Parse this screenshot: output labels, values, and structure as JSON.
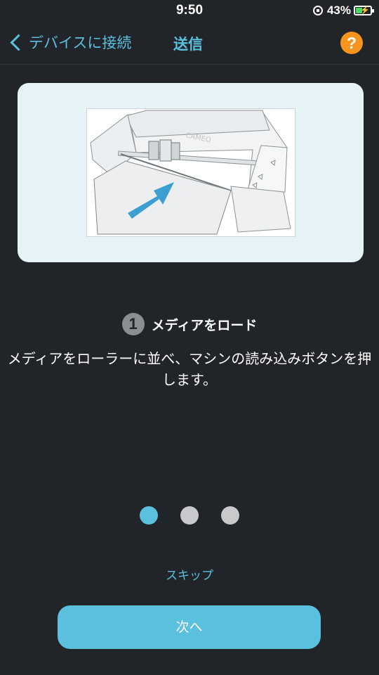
{
  "status_bar": {
    "time": "9:50",
    "battery_percent": "43%",
    "battery_level": 0.43,
    "icons": [
      "rotation-lock-icon",
      "battery-charging-icon"
    ]
  },
  "nav": {
    "back_label": "デバイスに接続",
    "title": "送信",
    "help_symbol": "?"
  },
  "illustration": {
    "machine_brand": "CAMEO"
  },
  "step": {
    "number": "1",
    "title": "メディアをロード",
    "description": "メディアをローラーに並べ、マシンの読み込みボタンを押します。"
  },
  "pager": {
    "total": 3,
    "current": 1
  },
  "actions": {
    "skip_label": "スキップ",
    "next_label": "次へ"
  },
  "colors": {
    "background": "#212428",
    "accent": "#5bc0de",
    "help": "#f7941d",
    "card": "#e6f3f6",
    "dot_inactive": "#c8c9cb"
  }
}
